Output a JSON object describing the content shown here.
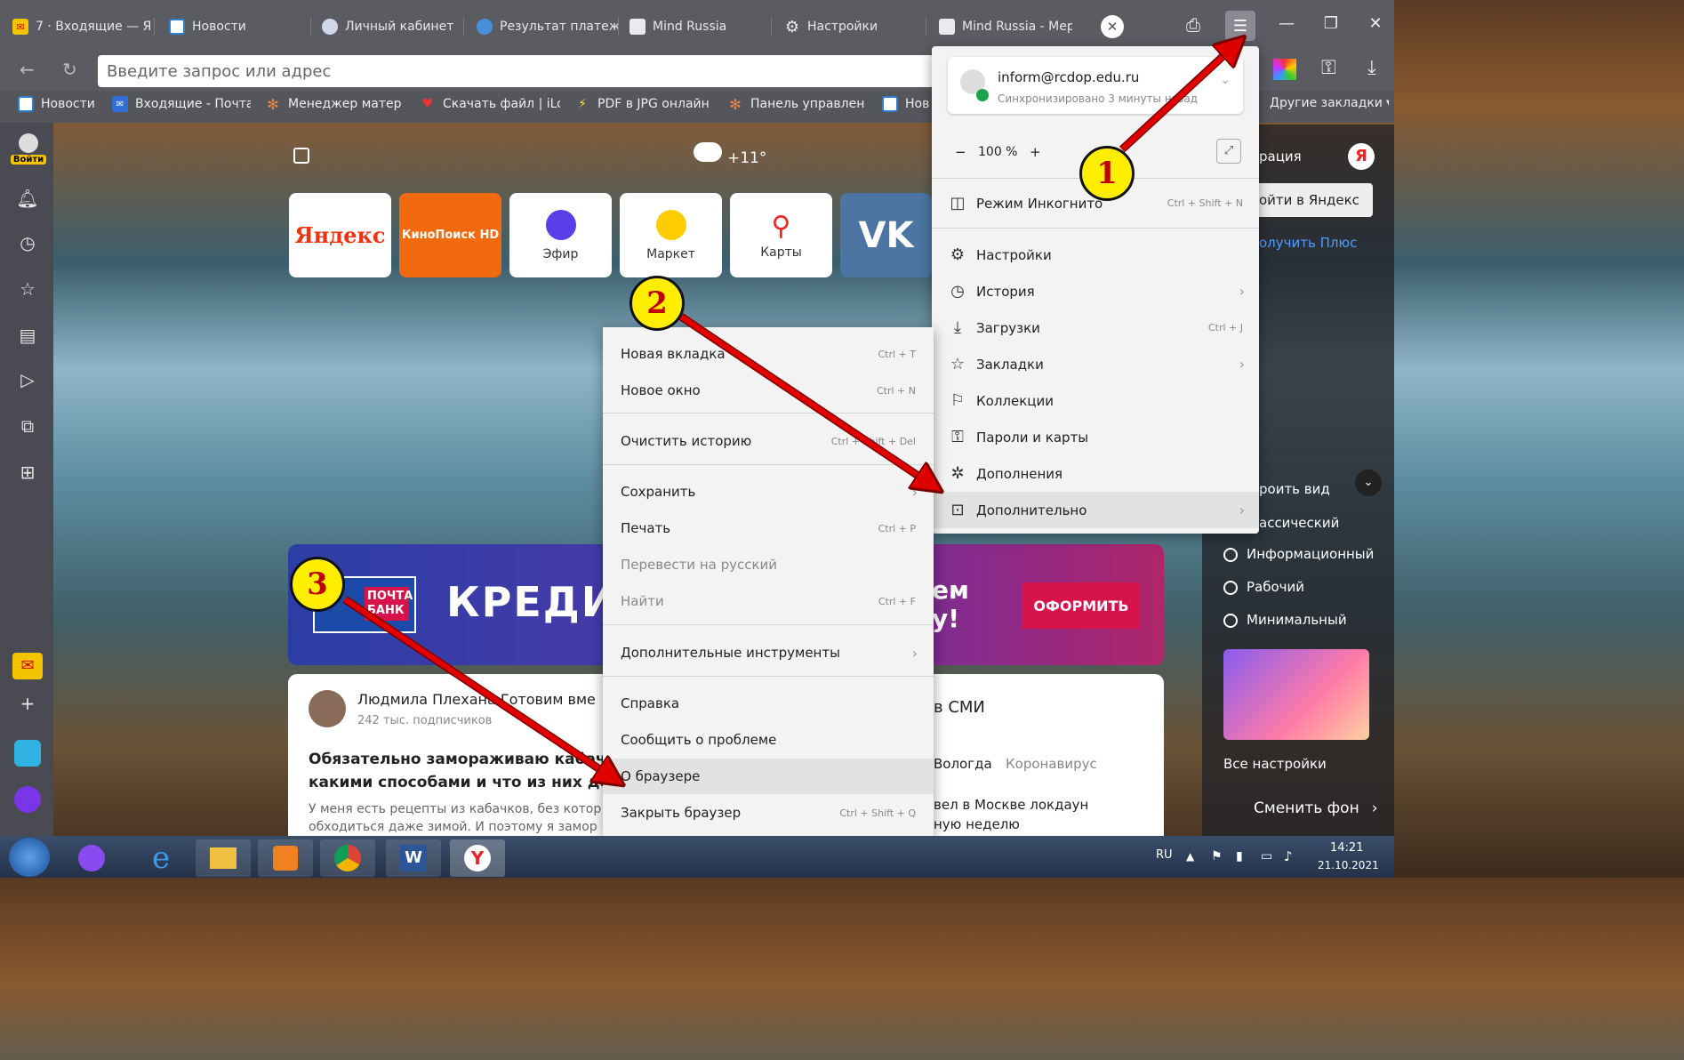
{
  "tabs": [
    {
      "label": "7 · Входящие — Я",
      "icon": "mail-icon"
    },
    {
      "label": "Новости",
      "icon": "news-icon"
    },
    {
      "label": "Личный кабинет",
      "icon": "shield-icon"
    },
    {
      "label": "Результат платеж",
      "icon": "globe-icon"
    },
    {
      "label": "Mind Russia",
      "icon": "shield-icon"
    },
    {
      "label": "Настройки",
      "icon": "gear-icon"
    },
    {
      "label": "Mind Russia - Мер",
      "icon": "shield-icon"
    }
  ],
  "address": {
    "placeholder": "Введите запрос или адрес"
  },
  "bookmarks": [
    {
      "label": "Новости"
    },
    {
      "label": "Входящие - Почта"
    },
    {
      "label": "Менеджер матер"
    },
    {
      "label": "Скачать файл | iLo"
    },
    {
      "label": "PDF в JPG онлайн"
    },
    {
      "label": "Панель управлен"
    },
    {
      "label": "Нов"
    }
  ],
  "other_bookmarks": "Другие закладки",
  "sidebar": {
    "login": "Войти"
  },
  "weather": "+11°",
  "tiles": [
    {
      "label": "Яндекс"
    },
    {
      "label": "КиноПоиск HD"
    },
    {
      "label": "Эфир"
    },
    {
      "label": "Маркет"
    },
    {
      "label": "Карты"
    },
    {
      "label": "VK"
    }
  ],
  "banner": {
    "title": "КРЕДИ",
    "tail": "ем\nу!",
    "button": "ОФОРМИТЬ",
    "logo": "ПОЧТА БАНК"
  },
  "card": {
    "author": "Людмила Плехан",
    "author_tail": "а Готовим вме",
    "subs": "242 тыс. подписчиков",
    "headline1": "Обязательно замораживаю кабач",
    "headline2": "какими способами и что из них делак",
    "snippet1": "У меня есть рецепты из кабачков, без котор",
    "snippet2": "обходиться даже зимой. И поэтому я замор"
  },
  "news": {
    "head": "в СМИ",
    "tag1": "Вологда",
    "tag2": "Коронавирус",
    "line1": "вел в Москве локдаун",
    "line2": "ную неделю"
  },
  "account": {
    "email": "inform@rcdop.edu.ru",
    "sync": "Синхронизировано 3 минуты назад"
  },
  "zoom": {
    "minus": "−",
    "value": "100 %",
    "plus": "+"
  },
  "main_menu": [
    {
      "label": "Режим Инкогнито",
      "shortcut": "Ctrl + Shift + N",
      "icon": "incognito-icon"
    },
    {
      "label": "Настройки",
      "icon": "gear-icon"
    },
    {
      "label": "История",
      "icon": "clock-icon"
    },
    {
      "label": "Загрузки",
      "shortcut": "Ctrl + J",
      "icon": "download-icon"
    },
    {
      "label": "Закладки",
      "icon": "star-icon"
    },
    {
      "label": "Коллекции",
      "icon": "bookmark-icon"
    },
    {
      "label": "Пароли и карты",
      "icon": "key-icon"
    },
    {
      "label": "Дополнения",
      "icon": "puzzle-icon"
    },
    {
      "label": "Дополнительно",
      "icon": "more-icon"
    }
  ],
  "sub_menu": [
    {
      "label": "Новая вкладка",
      "shortcut": "Ctrl + T"
    },
    {
      "label": "Новое окно",
      "shortcut": "Ctrl + N"
    },
    {
      "label": "Очистить историю",
      "shortcut": "Ctrl + Shift + Del"
    },
    {
      "label": "Сохранить"
    },
    {
      "label": "Печать",
      "shortcut": "Ctrl + P"
    },
    {
      "label": "Перевести на русский"
    },
    {
      "label": "Найти",
      "shortcut": "Ctrl + F"
    },
    {
      "label": "Дополнительные инструменты"
    },
    {
      "label": "Справка"
    },
    {
      "label": "Сообщить о проблеме"
    },
    {
      "label": "О браузере"
    },
    {
      "label": "Закрыть браузер",
      "shortcut": "Ctrl + Shift + Q"
    }
  ],
  "right_panel": {
    "reg": "рация",
    "login_yandex": "ойти в Яндекс",
    "plus": "олучить Плюс",
    "view": "роить вид",
    "classic": "ассический",
    "opt1": "Информационный",
    "opt2": "Рабочий",
    "opt3": "Минимальный",
    "all_settings": "Все настройки",
    "change_bg": "Сменить фон"
  },
  "callouts": [
    "1",
    "2",
    "3"
  ],
  "tray": {
    "lang": "RU",
    "time": "14:21",
    "date": "21.10.2021"
  },
  "colors": {
    "callout": "#ffee00",
    "arrow": "#e00000",
    "banner_button": "#d6134a"
  }
}
